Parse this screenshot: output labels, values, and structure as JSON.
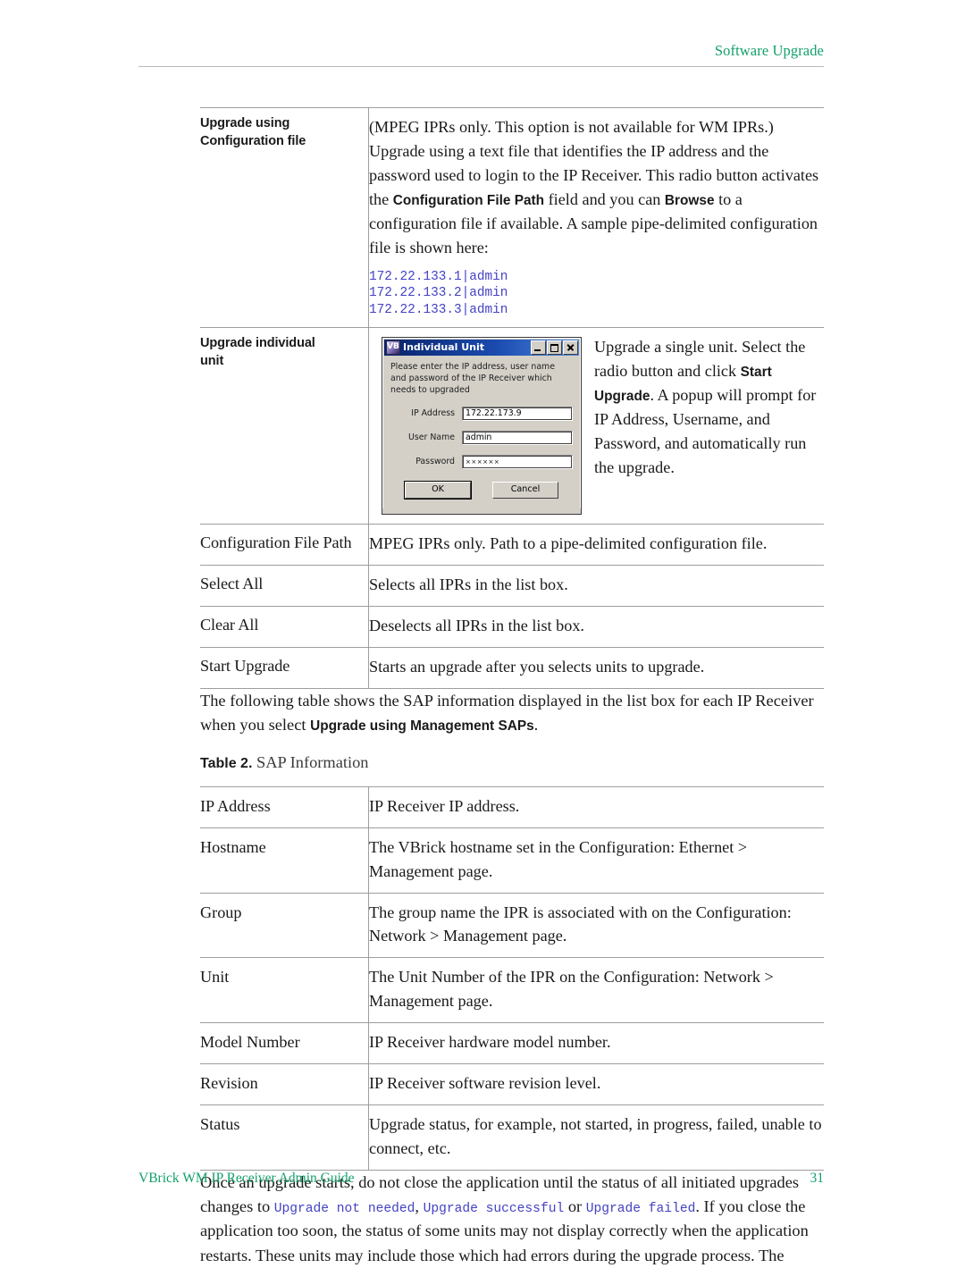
{
  "header": {
    "title": "Software Upgrade"
  },
  "footer": {
    "guide": "VBrick WM IP Receiver Admin Guide",
    "page_number": "31"
  },
  "colors": {
    "header_green": "#12a06a",
    "mono_blue": "#4442c4",
    "rule_gray": "#9e9e9e",
    "dialog_face": "#d4d0c8",
    "titlebar_blue": "#0a246a"
  },
  "table1": {
    "rows": [
      {
        "label": "Upgrade using Configuration file",
        "label_line1": "Upgrade using",
        "label_line2": "Configuration file",
        "desc_part1": "(MPEG IPRs only. This option is not available for WM IPRs.) Upgrade using a text file that identifies the IP address and the password used to login to the IP Receiver. This radio button activates the ",
        "desc_bold1": "Configuration File Path",
        "desc_part2": " field and you can ",
        "desc_bold2": "Browse",
        "desc_part3": " to a configuration file if available. A sample pipe-delimited configuration file is shown here:",
        "code": "172.22.133.1|admin\n172.22.133.2|admin\n172.22.133.3|admin"
      },
      {
        "label": "Upgrade individual unit",
        "label_line1": "Upgrade individual",
        "label_line2": "unit",
        "desc_part1": "Upgrade a single unit. Select the radio button and click ",
        "desc_bold1": "Start Upgrade",
        "desc_part2": ". A popup will prompt for IP Address, Username, and Password, and automatically run the upgrade."
      },
      {
        "label": "Configuration File Path",
        "desc": "MPEG IPRs only. Path to a pipe-delimited configuration file."
      },
      {
        "label": "Select All",
        "desc": "Selects all IPRs in the list box."
      },
      {
        "label": "Clear All",
        "desc": "Deselects all IPRs in the list box."
      },
      {
        "label": "Start Upgrade",
        "desc": "Starts an upgrade after you selects units to upgrade."
      }
    ]
  },
  "dialog": {
    "title": "Individual Unit",
    "icon": "vbrick-app-icon",
    "minimize_label": "minimize",
    "maximize_label": "maximize",
    "close_label": "close",
    "instruction": "Please enter the IP address, user name and password of the IP Receiver which needs to upgraded",
    "fields": [
      {
        "label": "IP Address",
        "value": "172.22.173.9"
      },
      {
        "label": "User Name",
        "value": "admin"
      },
      {
        "label": "Password",
        "value": "××××××"
      }
    ],
    "ok_label": "OK",
    "cancel_label": "Cancel"
  },
  "intro_paragraph": {
    "part1": "The following table shows the SAP information displayed in the list box for each IP Receiver when you select ",
    "bold": "Upgrade using Management SAPs",
    "part2": "."
  },
  "table2_caption": {
    "number": "Table 2.",
    "title": "SAP Information"
  },
  "table2": {
    "rows": [
      {
        "label": "IP Address",
        "desc": "IP Receiver IP address."
      },
      {
        "label": "Hostname",
        "desc": "The VBrick hostname set in the Configuration: Ethernet > Management page."
      },
      {
        "label": "Group",
        "desc": "The group name the IPR is associated with on the Configuration: Network > Management page."
      },
      {
        "label": "Unit",
        "desc": "The Unit Number of the IPR on the Configuration: Network > Management page."
      },
      {
        "label": "Model Number",
        "desc": "IP Receiver hardware model number."
      },
      {
        "label": "Revision",
        "desc": "IP Receiver software revision level."
      },
      {
        "label": "Status",
        "desc": "Upgrade status, for example, not started, in progress, failed, unable to connect, etc."
      }
    ]
  },
  "closing_paragraph": {
    "part1": "Once an upgrade starts, do not close the application until the status of all initiated upgrades changes to ",
    "code1": "Upgrade not needed",
    "part2": ", ",
    "code2": "Upgrade successful",
    "part3": " or ",
    "code3": "Upgrade failed",
    "part4": ". If you close the application too soon, the status of some units may not display correctly when the application restarts. These units may include those which had errors during the upgrade process. The"
  }
}
